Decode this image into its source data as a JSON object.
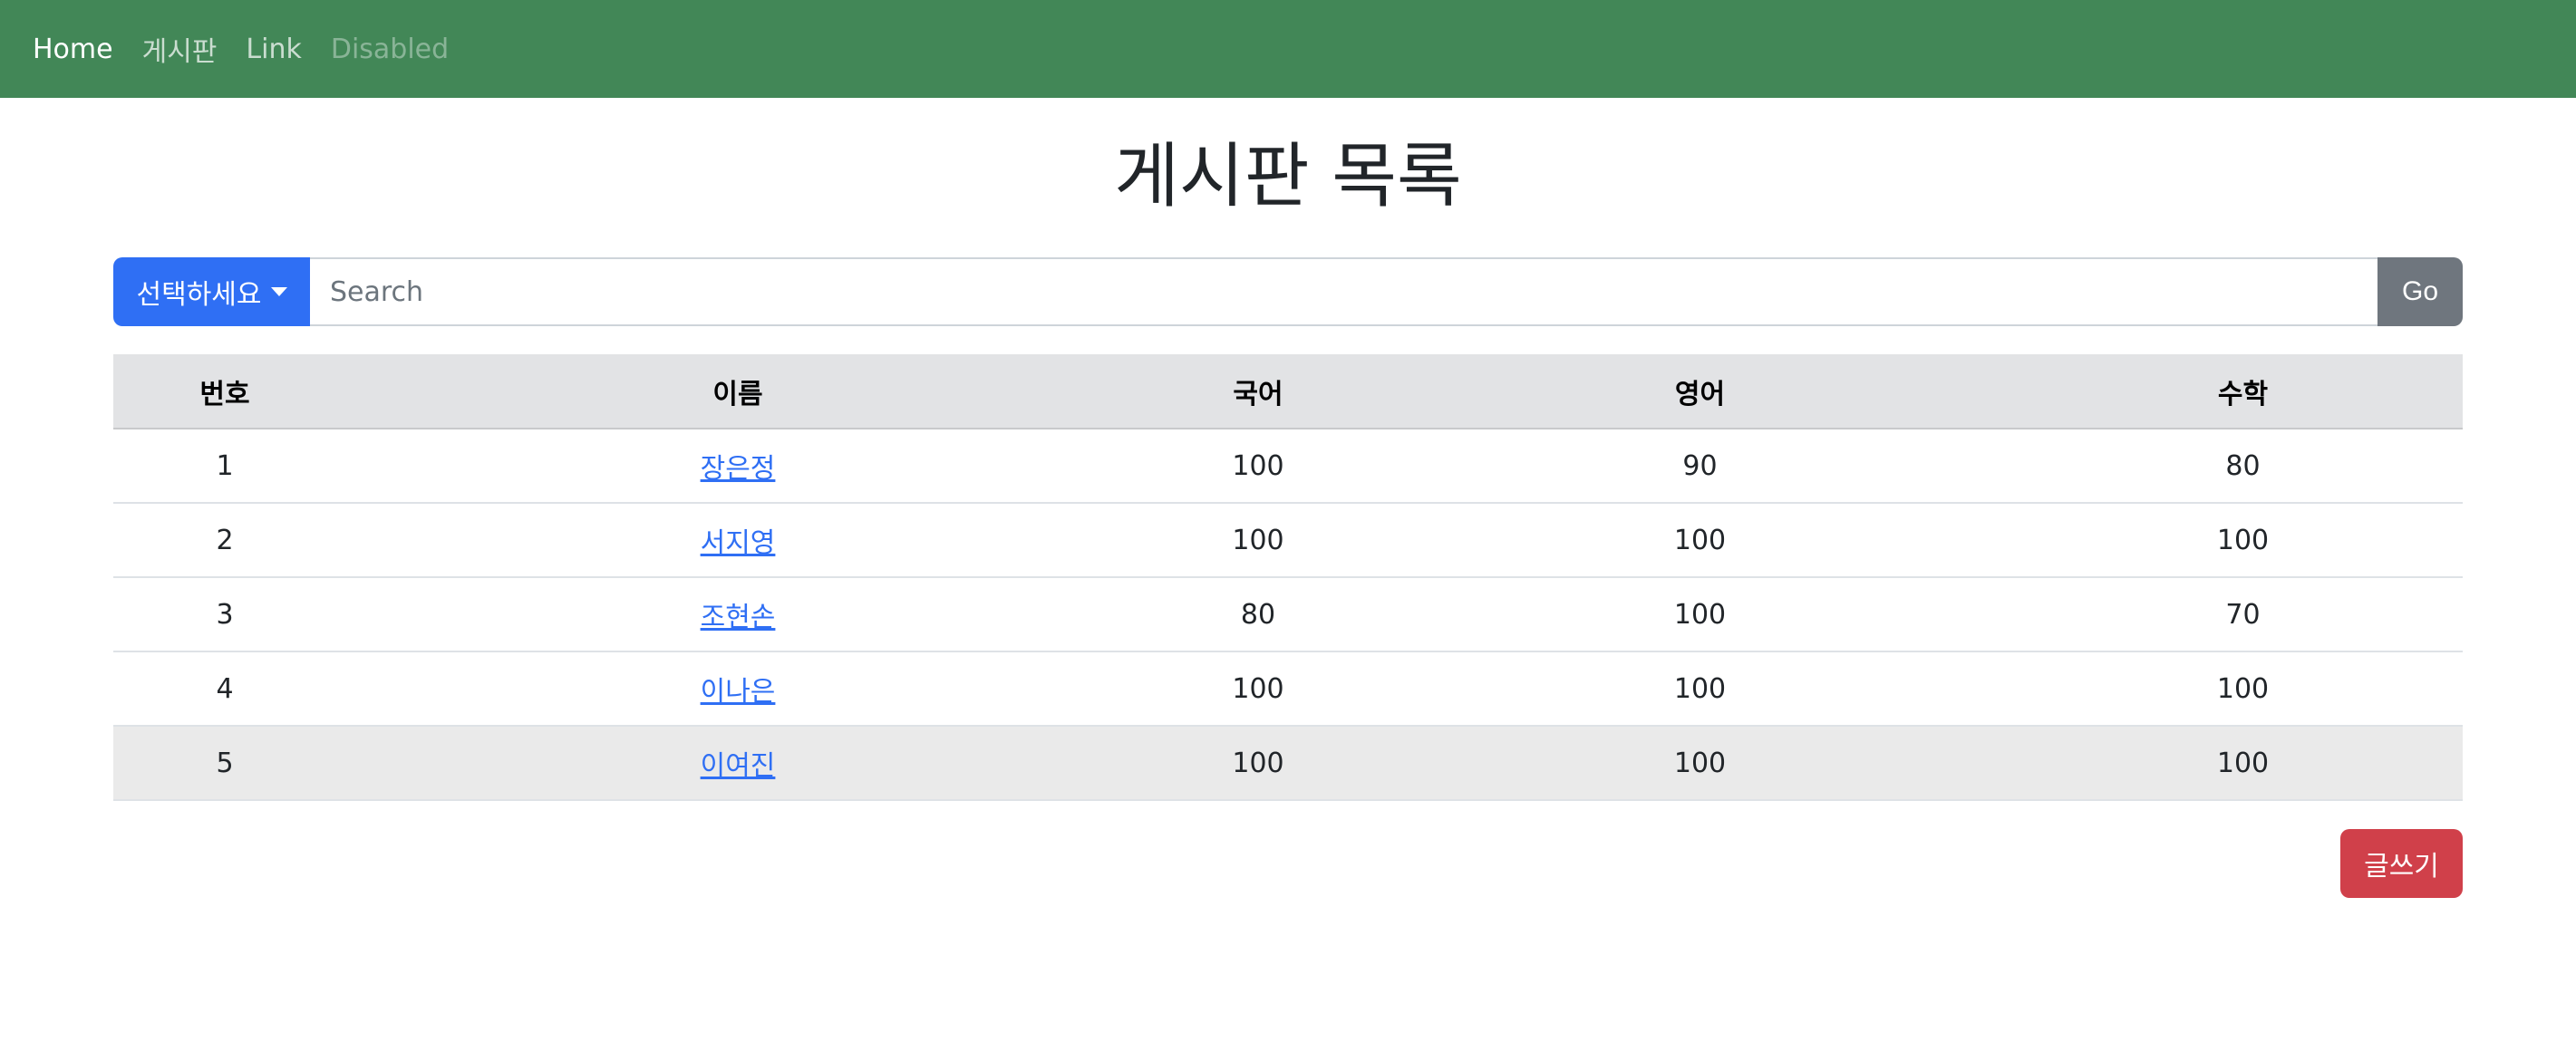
{
  "navbar": {
    "items": [
      {
        "label": "Home",
        "state": "active"
      },
      {
        "label": "게시판",
        "state": "normal"
      },
      {
        "label": "Link",
        "state": "normal"
      },
      {
        "label": "Disabled",
        "state": "disabled"
      }
    ],
    "bg_color": "#428757"
  },
  "page": {
    "title": "게시판 목록"
  },
  "search": {
    "dropdown_label": "선택하세요",
    "placeholder": "Search",
    "value": "",
    "go_label": "Go"
  },
  "table": {
    "headers": [
      "번호",
      "이름",
      "국어",
      "영어",
      "수학"
    ],
    "rows": [
      {
        "no": "1",
        "name": "장은정",
        "korean": "100",
        "english": "90",
        "math": "80"
      },
      {
        "no": "2",
        "name": "서지영",
        "korean": "100",
        "english": "100",
        "math": "100"
      },
      {
        "no": "3",
        "name": "조현손",
        "korean": "80",
        "english": "100",
        "math": "70"
      },
      {
        "no": "4",
        "name": "이나은",
        "korean": "100",
        "english": "100",
        "math": "100"
      },
      {
        "no": "5",
        "name": "이여진",
        "korean": "100",
        "english": "100",
        "math": "100"
      }
    ],
    "highlighted_row": 5
  },
  "actions": {
    "write_label": "글쓰기"
  },
  "colors": {
    "primary": "#2f6ff4",
    "secondary": "#6f767e",
    "danger": "#d0404a",
    "header_bg": "#e2e3e5"
  }
}
